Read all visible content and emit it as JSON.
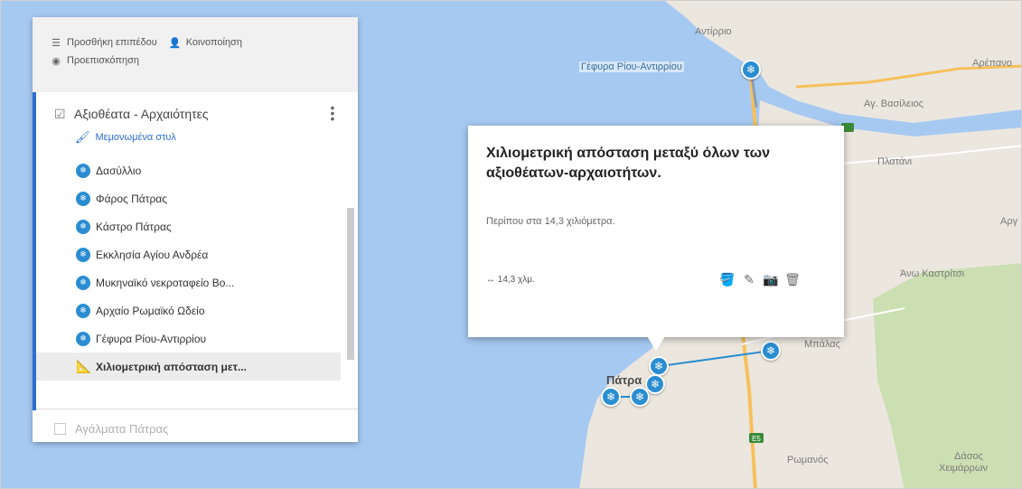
{
  "panel": {
    "toolbar": {
      "add_layer": "Προσθήκη επιπέδου",
      "share": "Κοινοποίηση",
      "preview": "Προεπισκόπηση"
    },
    "layer": {
      "title": "Αξιοθέατα - Αρχαιότητες",
      "style_link": "Μεμονωμένα στυλ",
      "items": [
        {
          "label": "Δασύλλιο",
          "icon": "landmark-pin-icon"
        },
        {
          "label": "Φάρος Πάτρας",
          "icon": "landmark-pin-icon"
        },
        {
          "label": "Κάστρο Πάτρας",
          "icon": "landmark-pin-icon"
        },
        {
          "label": "Εκκλησία Αγίου Ανδρέα",
          "icon": "landmark-pin-icon"
        },
        {
          "label": "Μυκηναϊκό νεκροταφείο Βο...",
          "icon": "landmark-pin-icon"
        },
        {
          "label": "Αρχαίο Ρωμαϊκό Ωδείο",
          "icon": "landmark-pin-icon"
        },
        {
          "label": "Γέφυρα Ρίου-Αντιρρίου",
          "icon": "landmark-pin-icon"
        },
        {
          "label": "Χιλιομετρική απόσταση μετ...",
          "icon": "ruler-icon",
          "selected": true
        }
      ]
    },
    "second_layer": {
      "title": "Αγάλματα Πάτρας"
    }
  },
  "info_window": {
    "title": "Χιλιομετρική απόσταση μεταξύ όλων των αξιοθέατων-αρχαιοτήτων.",
    "description": "Περίπου στα 14,3 χιλιόμετρα.",
    "measurement": "↔ 14,3 χλμ.",
    "tools": [
      "paint-bucket-icon",
      "pencil-icon",
      "camera-icon",
      "trash-icon"
    ]
  },
  "map": {
    "labels": {
      "antirrio": "Αντίρριο",
      "bridge": "Γέφυρα Ρίου-Αντιρρίου",
      "arepano": "Αρέπανο",
      "ag_vasileios": "Αγ. Βασίλειος",
      "platani": "Πλατάνι",
      "arg": "Αργ",
      "ano_kastritsi": "Άνω Καστρίτσι",
      "bala": "Μπάλας",
      "patra": "Πάτρα",
      "romanos": "Ρωμανός",
      "forest": "Δάσος",
      "forest2": "Χειμάρρων"
    },
    "road_shield": "E5",
    "colors": {
      "sea": "#a6c9f1",
      "land": "#ebe7df",
      "park": "#cbdfb2",
      "road": "#f7c05c",
      "pin": "#2b8dd1",
      "line": "#2b8dd1"
    }
  }
}
